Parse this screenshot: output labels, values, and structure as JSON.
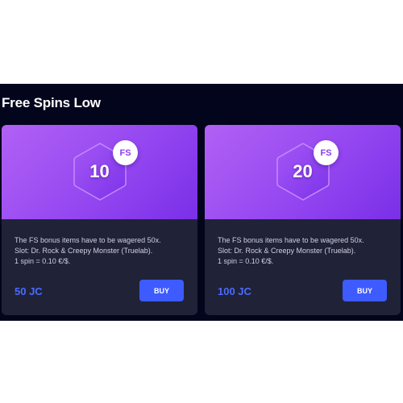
{
  "section": {
    "title": "Free Spins Low"
  },
  "cards": [
    {
      "spins": "10",
      "badge": "FS",
      "desc": [
        "The FS bonus items have to be wagered 50x.",
        "Slot: Dr. Rock & Creepy Monster (Truelab).",
        "1 spin = 0.10 €/$."
      ],
      "price": "50 JC",
      "buy_label": "BUY"
    },
    {
      "spins": "20",
      "badge": "FS",
      "desc": [
        "The FS bonus items have to be wagered 50x.",
        "Slot: Dr. Rock & Creepy Monster (Truelab).",
        "1 spin = 0.10 €/$."
      ],
      "price": "100 JC",
      "buy_label": "BUY"
    }
  ],
  "colors": {
    "background": "#02051c",
    "card": "#202238",
    "gradient_start": "#b161f4",
    "gradient_end": "#7a2fe8",
    "accent": "#3d5bff",
    "price": "#4a6bff"
  }
}
